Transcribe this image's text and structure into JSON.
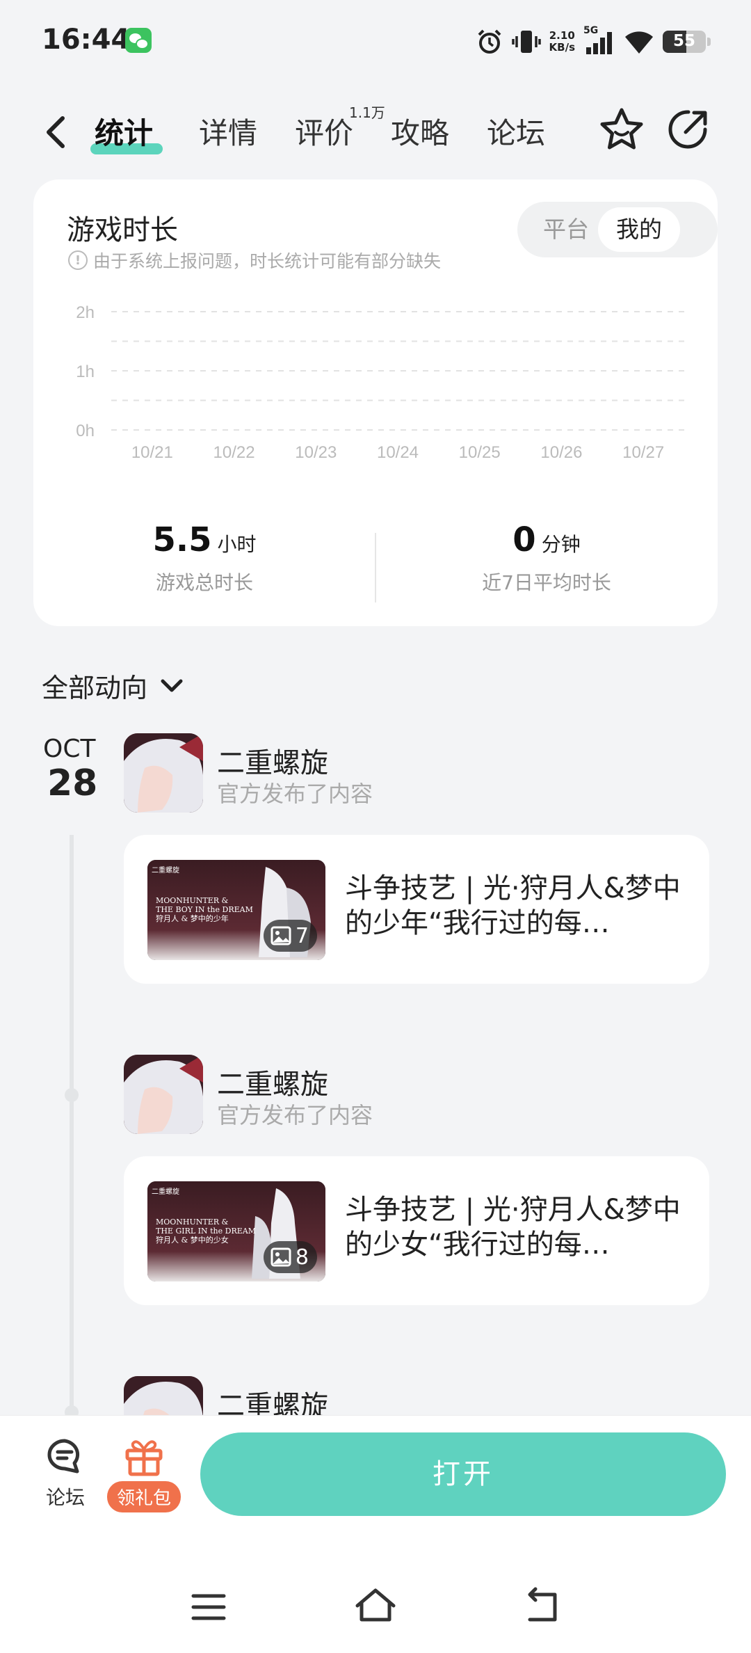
{
  "status_bar": {
    "time": "16:44",
    "net_speed_value": "2.10",
    "net_speed_unit": "KB/s",
    "network": "5G",
    "battery": "55",
    "battery_level": 0.55
  },
  "nav": {
    "tabs": [
      {
        "label": "统计",
        "active": true
      },
      {
        "label": "详情",
        "active": false
      },
      {
        "label": "评价",
        "active": false,
        "badge": "1.1万"
      },
      {
        "label": "攻略",
        "active": false
      },
      {
        "label": "论坛",
        "active": false
      }
    ]
  },
  "stats": {
    "title": "游戏时长",
    "notice": "由于系统上报问题，时长统计可能有部分缺失",
    "segment": {
      "options": [
        "平台",
        "我的"
      ],
      "selected": "我的"
    },
    "total": {
      "value": "5.5",
      "unit": "小时",
      "label": "游戏总时长"
    },
    "average": {
      "value": "0",
      "unit": "分钟",
      "label": "近7日平均时长"
    }
  },
  "chart_data": {
    "type": "bar",
    "categories": [
      "10/21",
      "10/22",
      "10/23",
      "10/24",
      "10/25",
      "10/26",
      "10/27"
    ],
    "values": [
      0,
      0,
      0,
      0,
      0,
      0,
      0
    ],
    "y_ticks": [
      "0h",
      "1h",
      "2h"
    ],
    "ylim": [
      0,
      2
    ],
    "grid": true,
    "title": "",
    "xlabel": "",
    "ylabel": ""
  },
  "feed": {
    "filter_label": "全部动向",
    "date": {
      "month": "OCT",
      "day": "28"
    },
    "posts": [
      {
        "author": "二重螺旋",
        "subtitle": "官方发布了内容",
        "title": "斗争技艺 | 光·狩月人&梦中的少年“我行过的每…",
        "image_count": "7",
        "thumb_tag": "二重螺旋",
        "thumb_line1": "MOONHUNTER &",
        "thumb_line2": "THE BOY IN the DREAM",
        "thumb_cn": "狩月人 & 梦中的少年"
      },
      {
        "author": "二重螺旋",
        "subtitle": "官方发布了内容",
        "title": "斗争技艺 | 光·狩月人&梦中的少女“我行过的每…",
        "image_count": "8",
        "thumb_tag": "二重螺旋",
        "thumb_line1": "MOONHUNTER &",
        "thumb_line2": "THE GIRL IN the DREAM",
        "thumb_cn": "狩月人 & 梦中的少女"
      },
      {
        "author": "二重螺旋"
      }
    ]
  },
  "bottom_bar": {
    "forum_label": "论坛",
    "gift_label": "领礼包",
    "open_label": "打开"
  },
  "colors": {
    "accent": "#5fd2bf",
    "gift": "#f0714b",
    "background": "#f3f4f6"
  }
}
